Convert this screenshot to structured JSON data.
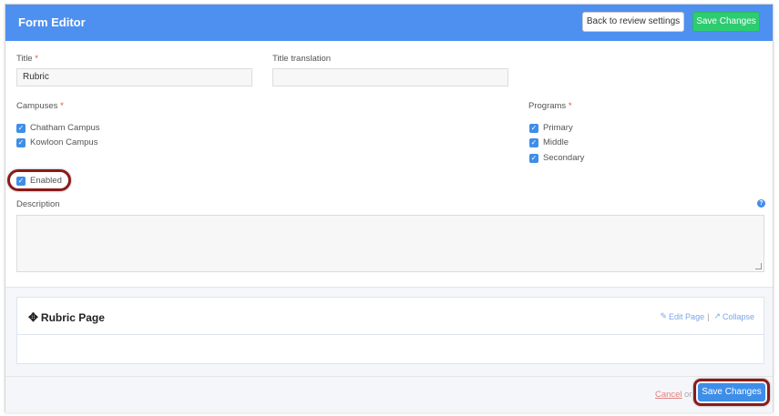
{
  "header": {
    "title": "Form Editor",
    "back_button": "Back to review settings",
    "save_button": "Save Changes"
  },
  "form": {
    "title_label": "Title",
    "title_value": "Rubric",
    "title_translation_label": "Title translation",
    "title_translation_value": "",
    "required_marker": "*",
    "campuses_label": "Campuses",
    "campuses": [
      {
        "label": "Chatham Campus",
        "checked": true
      },
      {
        "label": "Kowloon Campus",
        "checked": true
      }
    ],
    "programs_label": "Programs",
    "programs": [
      {
        "label": "Primary",
        "checked": true
      },
      {
        "label": "Middle",
        "checked": true
      },
      {
        "label": "Secondary",
        "checked": true
      }
    ],
    "enabled_label": "Enabled",
    "description_label": "Description",
    "help_icon": "?"
  },
  "page_panel": {
    "title": "Rubric Page",
    "edit_link": "Edit Page",
    "separator": "|",
    "collapse_link": "Collapse"
  },
  "footer": {
    "cancel_link": "Cancel",
    "or_text": "or",
    "save_button": "Save Changes"
  },
  "colors": {
    "header_bg": "#4e90f0",
    "save_top_bg": "#2ecc71",
    "save_bottom_bg": "#3e8ee8",
    "highlight": "#8b1a1a"
  }
}
